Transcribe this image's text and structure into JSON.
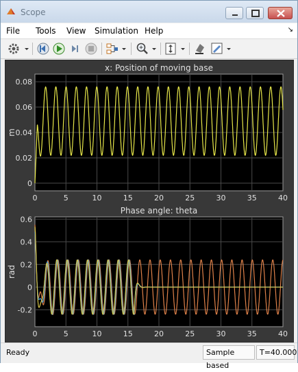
{
  "window": {
    "title": "Scope"
  },
  "menu": [
    "File",
    "Tools",
    "View",
    "Simulation",
    "Help"
  ],
  "toolbar_icons": [
    "gear-icon",
    "step-back-icon",
    "run-icon",
    "step-forward-icon",
    "stop-icon",
    "signal-selector-icon",
    "zoom-icon",
    "autoscale-icon",
    "highlight-icon",
    "style-icon"
  ],
  "colors": {
    "background": "#000000",
    "axes_bg": "#383838",
    "series1": "#e8e84a",
    "theta_orange": "#e0824a",
    "theta_blue": "#4fa3d9",
    "theta_yellow": "#d9c74a"
  },
  "chart_data": [
    {
      "type": "line",
      "title": "x: Position of moving base",
      "ylabel": "m",
      "xlim": [
        0,
        40
      ],
      "ylim": [
        -0.006,
        0.086
      ],
      "xticks": [
        0,
        5,
        10,
        15,
        20,
        25,
        30,
        35,
        40
      ],
      "yticks": [
        "0",
        "0.02",
        "0.04",
        "0.06",
        "0.08"
      ],
      "grid": true,
      "series": [
        {
          "values_description_free": true,
          "color": "#e8e84a",
          "mean": 0.049,
          "amplitude": 0.027,
          "period": 1.65,
          "start": 0,
          "peak_initial": 0.081
        }
      ]
    },
    {
      "type": "line",
      "title": "Phase angle: theta",
      "ylabel": "rad",
      "xlim": [
        0,
        40
      ],
      "ylim": [
        -0.35,
        0.62
      ],
      "xticks": [
        0,
        5,
        10,
        15,
        20,
        25,
        30,
        35,
        40
      ],
      "yticks": [
        "-0.2",
        "0",
        "0.2",
        "0.4",
        "0.6"
      ],
      "grid": true,
      "series": [
        {
          "color": "#e0824a",
          "amplitude": 0.22,
          "period": 1.65,
          "start": 0.55
        },
        {
          "color": "#4fa3d9",
          "amplitude": 0.22,
          "period": 1.65,
          "start": 0.48,
          "decay_after": 16
        },
        {
          "color": "#d9c74a",
          "amplitude": 0.22,
          "period": 1.65,
          "start": 0.52,
          "decay_after": 16
        }
      ]
    }
  ],
  "status": {
    "left": "Ready",
    "mode": "Sample based",
    "time": "T=40.000"
  }
}
